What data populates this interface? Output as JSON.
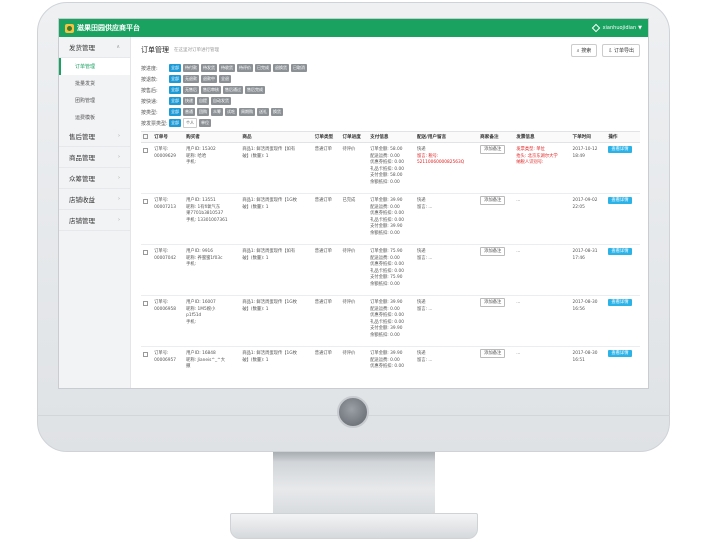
{
  "app": {
    "title": "滋果田园供应商平台",
    "user": "xianhuojidian"
  },
  "sidebar": {
    "groups": [
      {
        "label": "发货管理",
        "items": [
          "订单管理",
          "批量发货",
          "团购管理",
          "运费模板"
        ]
      },
      {
        "label": "售后管理"
      },
      {
        "label": "商品管理"
      },
      {
        "label": "众筹管理"
      },
      {
        "label": "店铺收益"
      },
      {
        "label": "店铺管理"
      }
    ]
  },
  "page": {
    "title": "订单管理",
    "subtitle": "在这里对订单进行管理",
    "search_button": "搜索",
    "export_button": "订单导出"
  },
  "filters": [
    {
      "label": "按进度:",
      "chips": [
        "全部",
        "待付款",
        "待发货",
        "待收货",
        "待评价",
        "已完成",
        "退换货",
        "已取消"
      ]
    },
    {
      "label": "按退款:",
      "chips": [
        "全部",
        "无退款",
        "退款中",
        "全退"
      ]
    },
    {
      "label": "按售后:",
      "chips": [
        "全部",
        "无售后",
        "售后审核",
        "售后通过",
        "售后完成"
      ]
    },
    {
      "label": "按快递:",
      "chips": [
        "全部",
        "快递",
        "自提",
        "自动发货"
      ]
    },
    {
      "label": "按类型:",
      "chips": [
        "全部",
        "普通",
        "团购",
        "众筹",
        "试吃",
        "周期购",
        "送礼",
        "换货"
      ]
    },
    {
      "label": "按发票类型:",
      "chips": [
        "全部",
        "个人",
        "单位"
      ]
    }
  ],
  "table": {
    "headers": [
      "订单号",
      "购买者",
      "商品",
      "订单类型",
      "订单进度",
      "支付信息",
      "配送/用户留言",
      "商家备注",
      "发票信息",
      "下单时间",
      "操作"
    ],
    "note_button": "添加备注",
    "detail_button": "查看详情",
    "rows": [
      {
        "order": [
          "订单号:",
          "00009629"
        ],
        "buyer": [
          "用户ID: 15302",
          "昵称: 哈哈",
          "手机:"
        ],
        "goods": [
          "商品1: 鲜活周蛋现传【如有",
          "破】(数量): 1"
        ],
        "type": "普通订单",
        "status": "待评价",
        "pay": [
          "订单金额: 58.00",
          "配送运费: 0.00",
          "优惠券抵扣: 0.00",
          "礼品卡抵扣: 0.00",
          "支付金额: 58.00",
          "余额抵扣: 0.00"
        ],
        "delivery": [
          "快递",
          "留言: 税号:",
          "5211006000082563Q"
        ],
        "invoice": [
          "发票类型: 单位",
          "抬头: 北京东湖尔大学",
          "纳税人识别号:"
        ],
        "time": [
          "2017-10-12",
          "18:49"
        ]
      },
      {
        "order": [
          "订单号:",
          "00007213"
        ],
        "buyer": [
          "用户ID: 13551",
          "昵称: 1有fi氧气东",
          "果7701b3810537",
          "手机: 13301007361"
        ],
        "goods": [
          "商品1: 鲜活周蛋现传【1G枚",
          "破】(数量): 1"
        ],
        "type": "普通订单",
        "status": "已完成",
        "pay": [
          "订单金额: 39.90",
          "配送运费: 0.00",
          "优惠券抵扣: 0.00",
          "礼品卡抵扣: 0.00",
          "支付金额: 39.90",
          "余额抵扣: 0.00"
        ],
        "delivery": [
          "快递",
          "留言: ..."
        ],
        "invoice": [
          "..."
        ],
        "time": [
          "2017-09-02",
          "22:05"
        ]
      },
      {
        "order": [
          "订单号:",
          "00007042"
        ],
        "buyer": [
          "用户ID: 9916",
          "昵称: 养蜜蜜1f03c",
          "手机:"
        ],
        "goods": [
          "商品1: 鲜活周蛋现传【如有",
          "破】(数量): 1"
        ],
        "type": "普通订单",
        "status": "待评价",
        "pay": [
          "订单金额: 75.90",
          "配送运费: 0.00",
          "优惠券抵扣: 0.00",
          "礼品卡抵扣: 0.00",
          "支付金额: 75.90",
          "余额抵扣: 0.00"
        ],
        "delivery": [
          "快递",
          "留言: ..."
        ],
        "invoice": [
          "..."
        ],
        "time": [
          "2017-08-31",
          "17:46"
        ]
      },
      {
        "order": [
          "订单号:",
          "00006958"
        ],
        "buyer": [
          "用户ID: 16007",
          "昵称: 1M5婉小",
          "p1f51d",
          "手机:"
        ],
        "goods": [
          "商品1: 鲜活周蛋现传【1G枚",
          "破】(数量): 1"
        ],
        "type": "普通订单",
        "status": "待评价",
        "pay": [
          "订单金额: 39.90",
          "配送运费: 0.00",
          "优惠券抵扣: 0.00",
          "礼品卡抵扣: 0.00",
          "支付金额: 39.90",
          "余额抵扣: 0.00"
        ],
        "delivery": [
          "快递",
          "留言: ..."
        ],
        "invoice": [
          "..."
        ],
        "time": [
          "2017-08-30",
          "16:56"
        ]
      },
      {
        "order": [
          "订单号:",
          "00006957"
        ],
        "buyer": [
          "用户ID: 16848",
          "昵称: Jianeis^_^大",
          "撒"
        ],
        "goods": [
          "商品1: 鲜活周蛋现传【1G枚",
          "破】(数量): 1"
        ],
        "type": "普通订单",
        "status": "待评价",
        "pay": [
          "订单金额: 39.90",
          "配送运费: 0.00",
          "优惠券抵扣: 0.00"
        ],
        "delivery": [
          "快递",
          "留言: ..."
        ],
        "invoice": [
          "..."
        ],
        "time": [
          "2017-08-30",
          "16:51"
        ]
      }
    ]
  },
  "colors": {
    "brand": "#1aa261",
    "accent_chip": "#1d9bd7",
    "detail_button": "#2bb3e8",
    "alert_text": "#e02020"
  }
}
